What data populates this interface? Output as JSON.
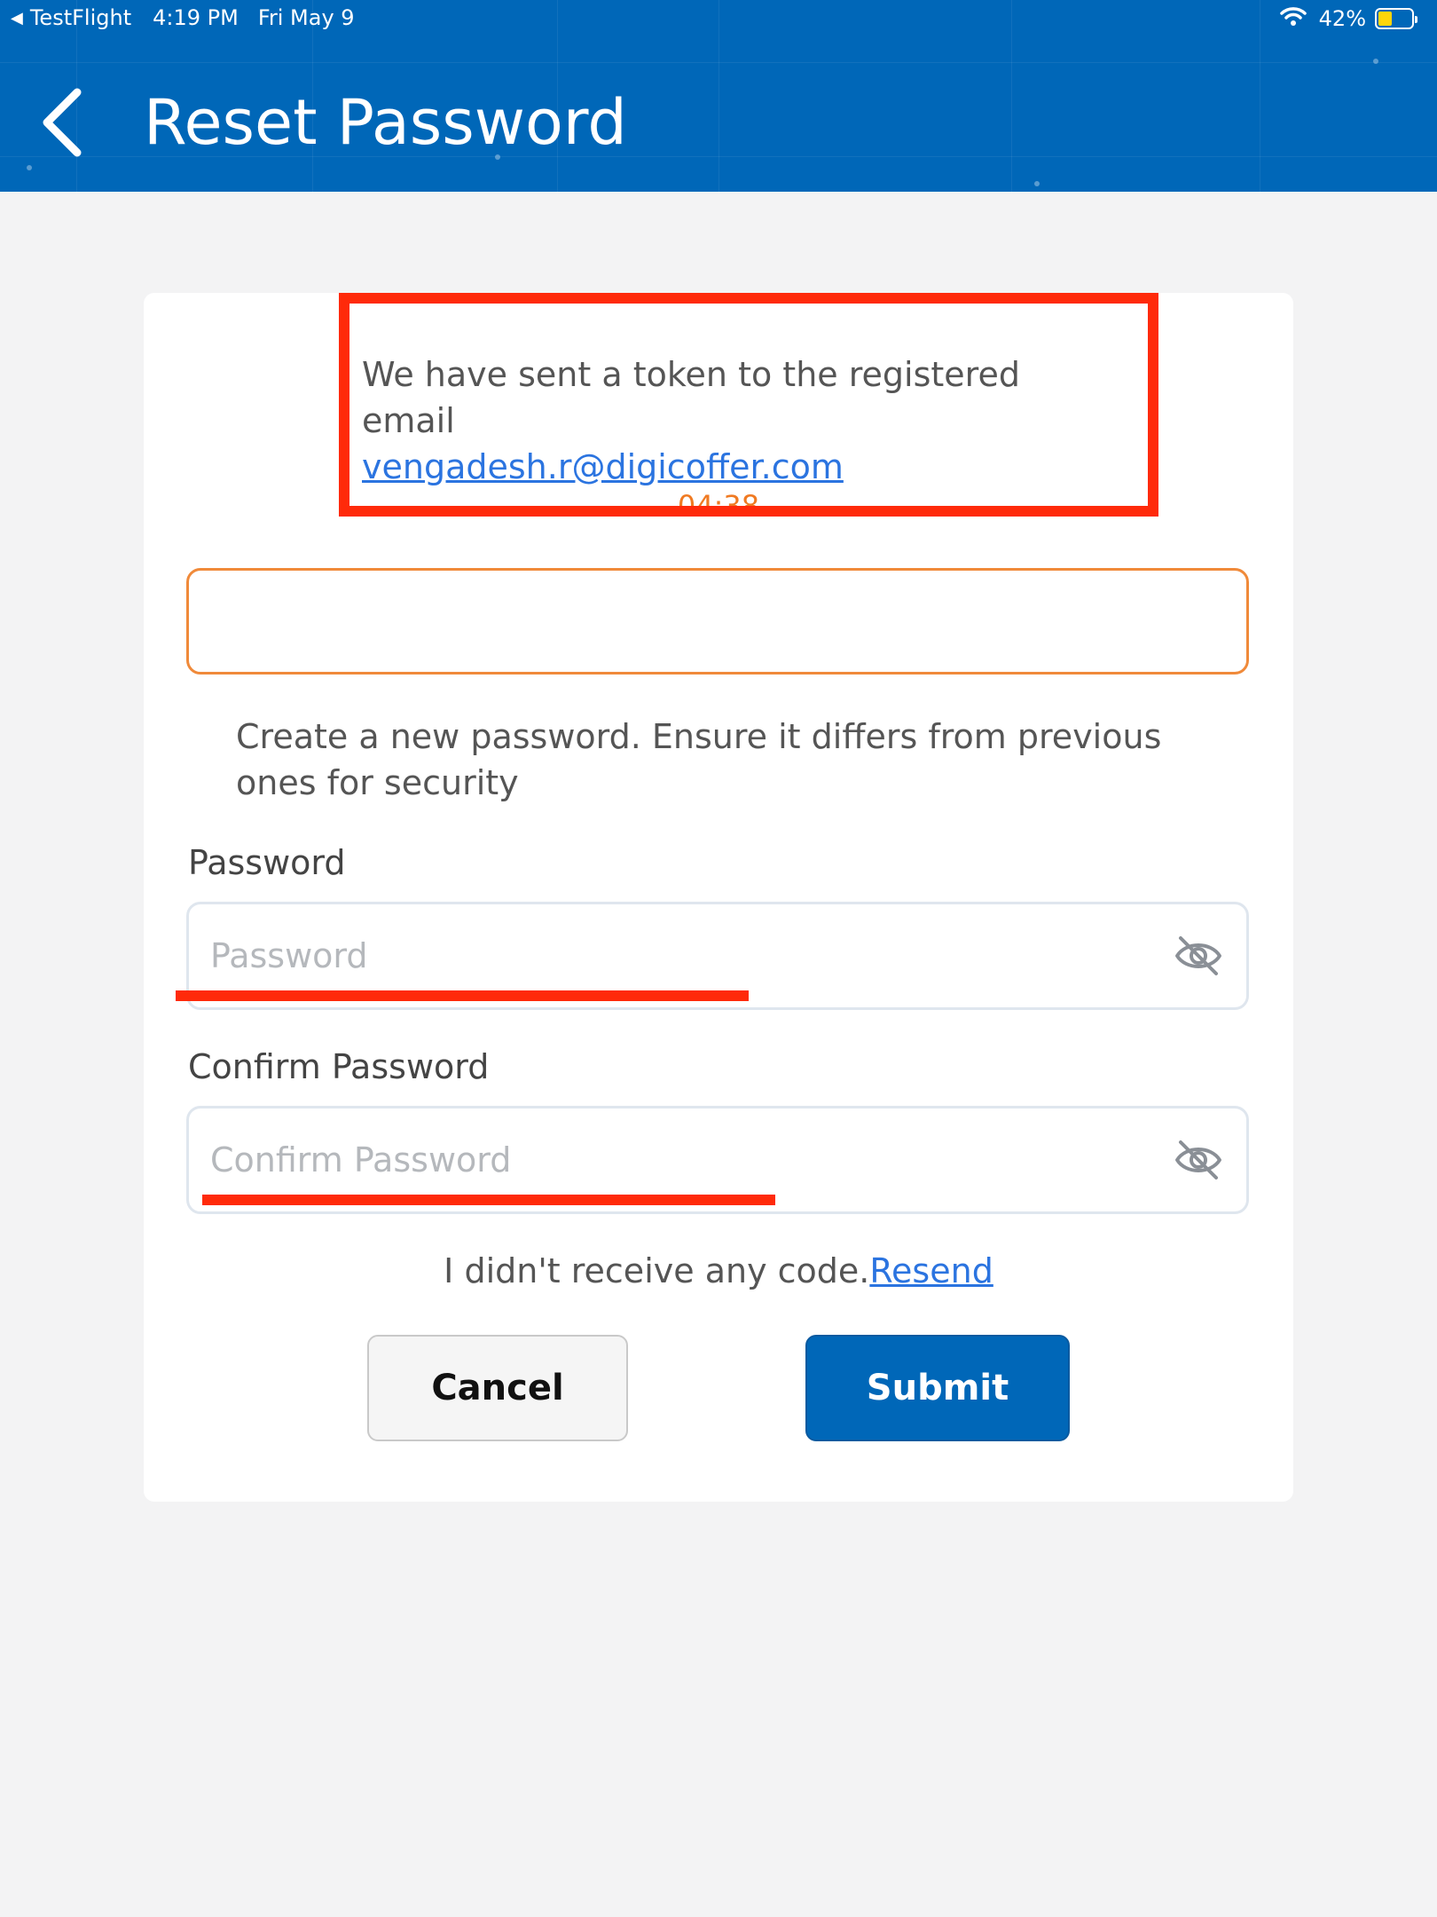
{
  "status_bar": {
    "back_app": "TestFlight",
    "time": "4:19 PM",
    "date": "Fri May 9",
    "battery_pct": "42%",
    "battery_level": 0.42
  },
  "header": {
    "title": "Reset Password",
    "bg_color": "#0067b8"
  },
  "notice": {
    "message": "We have sent a token to the registered email",
    "email": "vengadesh.r@digicoffer.com",
    "timer": "04:38"
  },
  "token_input": {
    "value": "",
    "placeholder": ""
  },
  "instruction": "Create a new password. Ensure it differs from previous ones for security",
  "password": {
    "label": "Password",
    "placeholder": "Password",
    "icon": "eye-off-icon"
  },
  "confirm_password": {
    "label": "Confirm Password",
    "placeholder": "Confirm Password",
    "icon": "eye-off-icon"
  },
  "resend": {
    "text": "I didn't receive any code.",
    "link": "Resend"
  },
  "buttons": {
    "cancel": "Cancel",
    "submit": "Submit"
  },
  "colors": {
    "accent": "#0067b8",
    "link": "#2b74e0",
    "timer": "#f07a22",
    "annotation": "#ff2a0a"
  }
}
